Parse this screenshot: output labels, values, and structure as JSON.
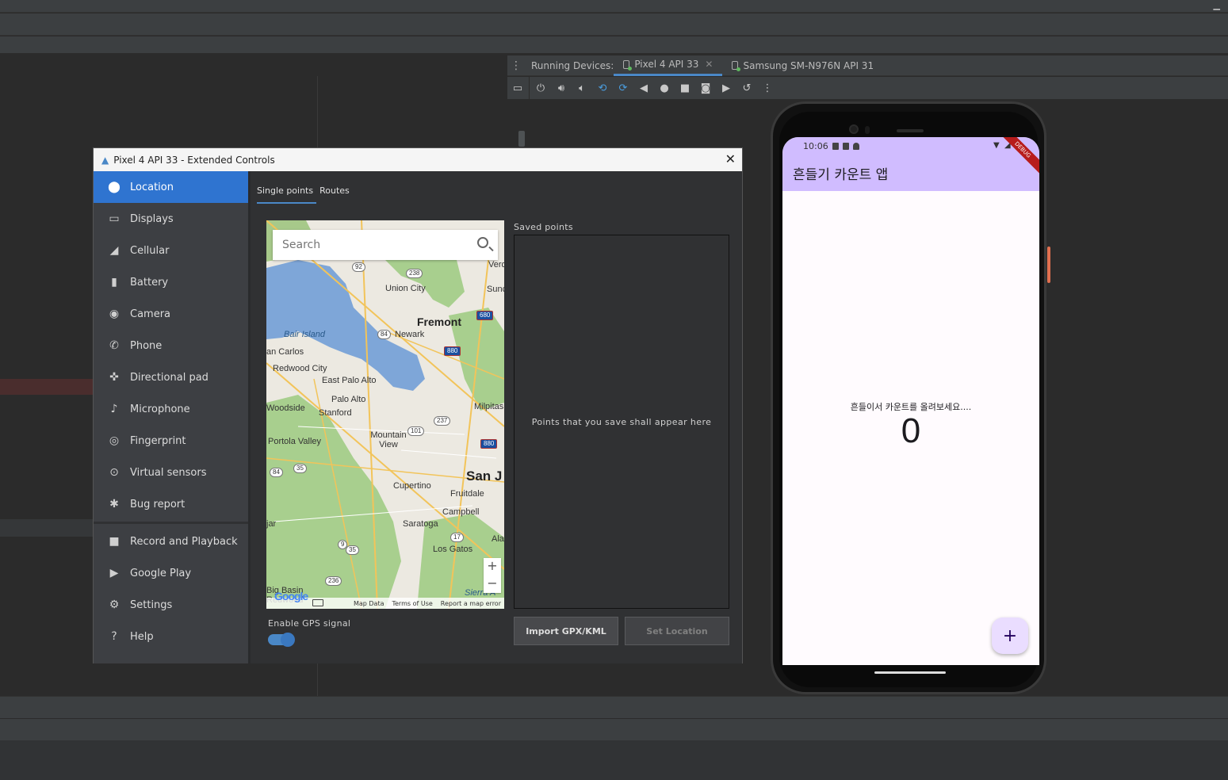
{
  "ide": {
    "running_devices_label": "Running Devices:",
    "tabs": [
      {
        "label": "Pixel 4 API 33",
        "active": true,
        "closable": true
      },
      {
        "label": "Samsung SM-N976N API 31",
        "active": false,
        "closable": false
      }
    ],
    "toolbar_icons": [
      "display-icon",
      "power-icon",
      "volume-up-icon",
      "volume-down-icon",
      "rotate-left-icon",
      "rotate-right-icon",
      "back-icon",
      "home-icon",
      "overview-icon",
      "screenshot-icon",
      "screenrecord-icon",
      "snapshot-icon",
      "more-icon"
    ]
  },
  "extended_controls": {
    "title": "Pixel 4 API 33 - Extended Controls",
    "sidebar": [
      {
        "label": "Location",
        "icon": "location-pin-icon",
        "active": true
      },
      {
        "label": "Displays",
        "icon": "display-icon"
      },
      {
        "label": "Cellular",
        "icon": "cellular-icon"
      },
      {
        "label": "Battery",
        "icon": "battery-icon"
      },
      {
        "label": "Camera",
        "icon": "camera-icon"
      },
      {
        "label": "Phone",
        "icon": "phone-icon"
      },
      {
        "label": "Directional pad",
        "icon": "dpad-icon"
      },
      {
        "label": "Microphone",
        "icon": "microphone-icon"
      },
      {
        "label": "Fingerprint",
        "icon": "fingerprint-icon"
      },
      {
        "label": "Virtual sensors",
        "icon": "sensors-icon"
      },
      {
        "label": "Bug report",
        "icon": "bug-icon"
      },
      {
        "label": "Record and Playback",
        "icon": "record-icon"
      },
      {
        "label": "Google Play",
        "icon": "google-play-icon"
      },
      {
        "label": "Settings",
        "icon": "gear-icon"
      },
      {
        "label": "Help",
        "icon": "help-icon"
      }
    ],
    "tabs": [
      {
        "label": "Single points",
        "active": true
      },
      {
        "label": "Routes",
        "active": false
      }
    ],
    "map": {
      "search_placeholder": "Search",
      "labels": [
        "Union City",
        "Fremont",
        "Newark",
        "Bair Island",
        "an Carlos",
        "Redwood City",
        "East Palo Alto",
        "Palo Alto",
        "Woodside",
        "Stanford",
        "Milpitas",
        "Portola Valley",
        "Mountain View",
        "San J",
        "Cupertino",
        "Fruitdale",
        "Campbell",
        "Saratoga",
        "Los Gatos",
        "Big Basin",
        "Redwood",
        "Sierra A",
        "Verd",
        "Sunc",
        "jar",
        "Ala"
      ],
      "shields": [
        "92",
        "238",
        "680",
        "84",
        "880",
        "237",
        "101",
        "880",
        "84",
        "35",
        "17",
        "9",
        "35",
        "236"
      ],
      "zoom_in": "+",
      "zoom_out": "−",
      "footer": [
        "Map Data",
        "Terms of Use",
        "Report a map error"
      ],
      "logo": "Google"
    },
    "gps_label": "Enable GPS signal",
    "gps_enabled": true,
    "saved_points_label": "Saved points",
    "saved_points_empty": "Points that you save shall appear here",
    "import_button": "Import GPX/KML",
    "set_location_button": "Set Location"
  },
  "phone": {
    "time": "10:06",
    "debug_ribbon": "DEBUG",
    "app_title": "흔들기 카운트 앱",
    "message": "흔들이서 카운트를 올려보세요....",
    "count": "0",
    "fab": "+"
  }
}
